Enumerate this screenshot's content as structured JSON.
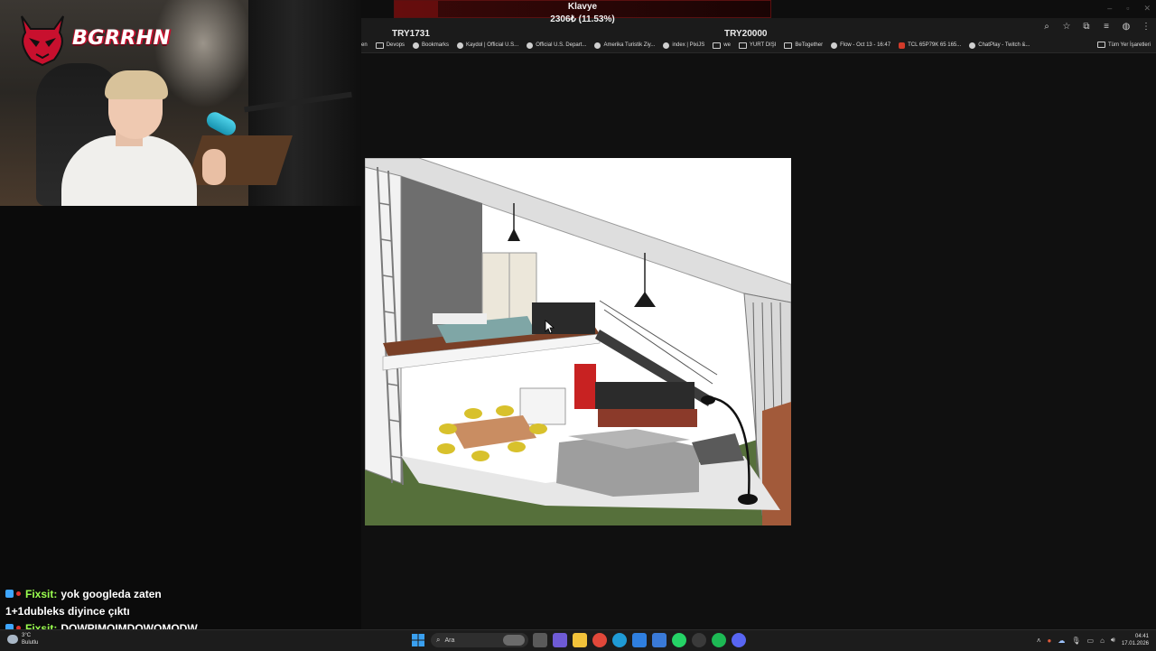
{
  "overlay": {
    "logo_text": "BGRRHN",
    "donation": {
      "title": "Klavye",
      "amount": "2306₺ (11.53%)",
      "progress_percent": 11.53,
      "min_label": "TRY1731",
      "max_label": "TRY20000"
    }
  },
  "browser": {
    "bookmarks": [
      {
        "label": "en",
        "icon": "none"
      },
      {
        "label": "Devops",
        "icon": "folder-icon"
      },
      {
        "label": "Bookmarks",
        "icon": "globe-icon"
      },
      {
        "label": "Kaydol | Official U.S...",
        "icon": "globe-icon"
      },
      {
        "label": "Official U.S. Depart...",
        "icon": "link-icon"
      },
      {
        "label": "Amerika Turistik Ziy...",
        "icon": "globe-icon"
      },
      {
        "label": "index | PixiJS",
        "icon": "globe-icon"
      },
      {
        "label": "we",
        "icon": "folder-icon"
      },
      {
        "label": "YURT DIŞI",
        "icon": "folder-icon"
      },
      {
        "label": "BeTogether",
        "icon": "folder-icon"
      },
      {
        "label": "Flow - Oct 13 - 16:47",
        "icon": "globe-icon"
      },
      {
        "label": "TCL 65P79K 65 165...",
        "icon": "red-icon"
      },
      {
        "label": "ChatPlay - Twitch &...",
        "icon": "globe-icon"
      }
    ],
    "bookmarks_end": "Tüm Yer İşaretleri",
    "toolbar_icons": [
      "zoom-icon",
      "star-icon",
      "extensions-icon",
      "media-icon",
      "profile-icon",
      "menu-icon"
    ]
  },
  "chat": {
    "messages": [
      {
        "user": "Fixsit:",
        "text": "yok googleda zaten",
        "badges": true
      },
      {
        "user": "",
        "text": "1+1dubleks diyince çıktı",
        "badges": false
      },
      {
        "user": "Fixsit:",
        "text": "DOWPIMQIMDQWOMQDW",
        "badges": true
      }
    ]
  },
  "taskbar": {
    "weather": {
      "temp": "3°C",
      "condition": "Bulutlu"
    },
    "search_placeholder": "Ara",
    "apps": [
      {
        "name": "task-view-icon",
        "color": "#5a5a5a"
      },
      {
        "name": "copilot-icon",
        "color": "#6f5bd6"
      },
      {
        "name": "file-explorer-icon",
        "color": "#f2c23a"
      },
      {
        "name": "chrome-icon",
        "color": "#e2483a"
      },
      {
        "name": "edge-icon",
        "color": "#1f9bd6"
      },
      {
        "name": "store-icon",
        "color": "#2f7fe0"
      },
      {
        "name": "mail-icon",
        "color": "#3a7ad8"
      },
      {
        "name": "whatsapp-icon",
        "color": "#25d366"
      },
      {
        "name": "obs-icon",
        "color": "#3a3a3a"
      },
      {
        "name": "spotify-icon",
        "color": "#1db954"
      },
      {
        "name": "discord-icon",
        "color": "#5865f2"
      }
    ],
    "time": "04:41",
    "date": "17.01.2026"
  }
}
